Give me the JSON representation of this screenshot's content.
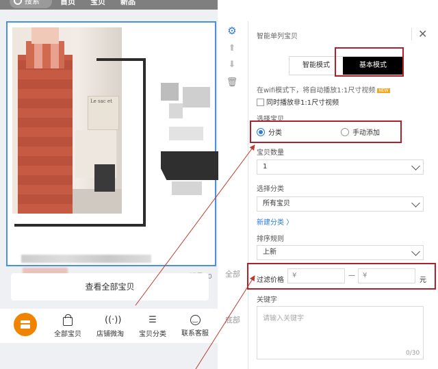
{
  "phone": {
    "search_label": "搜索",
    "nav": [
      "首页",
      "宝贝",
      "新品"
    ],
    "product_book_text": "Le sac et",
    "sales_label": "销量: 0",
    "view_all_label": "查看全部宝贝",
    "tabs": [
      "全部宝贝",
      "店铺微淘",
      "宝贝分类",
      "联系客服"
    ]
  },
  "side_buttons": [
    "全部",
    "底部"
  ],
  "panel": {
    "title": "智能单列宝贝",
    "mode_smart": "智能模式",
    "mode_basic": "基本模式",
    "wifi_hint": "在wifi模式下，将自动播放1:1尺寸视频",
    "wifi_badge": "NEW",
    "also_play_label": "同时播放非1:1尺寸视频",
    "select_item_label": "选择宝贝",
    "radio_category": "分类",
    "radio_manual": "手动添加",
    "count_label": "宝贝数量",
    "count_value": "1",
    "category_label": "选择分类",
    "category_value": "所有宝贝",
    "new_category_link": "新建分类 〉",
    "sort_label": "排序规则",
    "sort_value": "上新",
    "price_label": "过滤价格",
    "price_min_placeholder": "¥",
    "price_max_placeholder": "¥",
    "price_separator": "—",
    "price_unit": "元",
    "keyword_label": "关键字",
    "keyword_placeholder": "请输入关键字",
    "keyword_counter": "0/30"
  },
  "colors": {
    "accent_blue": "#2f7bd6",
    "highlight_red": "#b0202a",
    "shop_orange": "#f08300"
  }
}
